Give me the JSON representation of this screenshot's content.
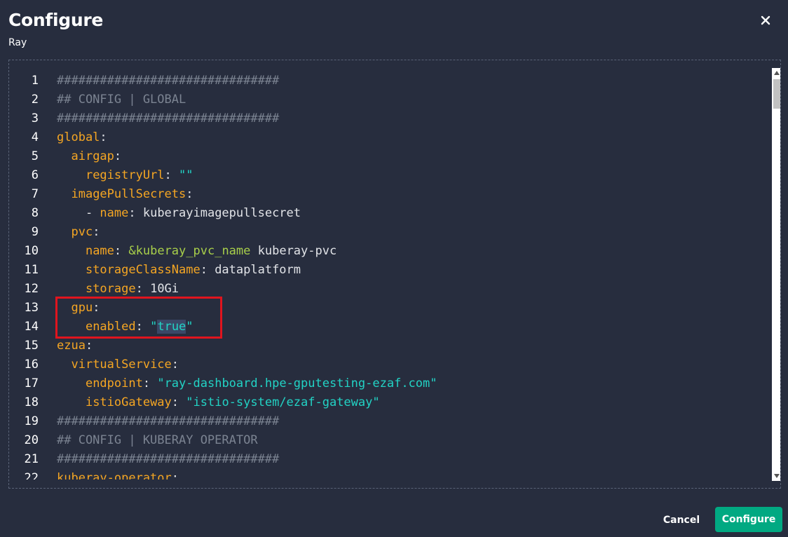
{
  "dialog": {
    "title": "Configure",
    "subtitle": "Ray",
    "close_icon": "close-icon"
  },
  "editor": {
    "lines": [
      {
        "num": "1",
        "segs": [
          {
            "t": "###############################",
            "c": "comment"
          }
        ]
      },
      {
        "num": "2",
        "segs": [
          {
            "t": "## CONFIG | GLOBAL",
            "c": "comment"
          }
        ]
      },
      {
        "num": "3",
        "segs": [
          {
            "t": "###############################",
            "c": "comment"
          }
        ]
      },
      {
        "num": "4",
        "segs": [
          {
            "t": "global",
            "c": "key"
          },
          {
            "t": ":",
            "c": "plain"
          }
        ]
      },
      {
        "num": "5",
        "segs": [
          {
            "t": "  ",
            "c": "plain"
          },
          {
            "t": "airgap",
            "c": "key"
          },
          {
            "t": ":",
            "c": "plain"
          }
        ]
      },
      {
        "num": "6",
        "segs": [
          {
            "t": "    ",
            "c": "plain"
          },
          {
            "t": "registryUrl",
            "c": "key"
          },
          {
            "t": ": ",
            "c": "plain"
          },
          {
            "t": "\"\"",
            "c": "str"
          }
        ]
      },
      {
        "num": "7",
        "segs": [
          {
            "t": "  ",
            "c": "plain"
          },
          {
            "t": "imagePullSecrets",
            "c": "key"
          },
          {
            "t": ":",
            "c": "plain"
          }
        ]
      },
      {
        "num": "8",
        "segs": [
          {
            "t": "    - ",
            "c": "plain"
          },
          {
            "t": "name",
            "c": "key"
          },
          {
            "t": ": kuberayimagepullsecret",
            "c": "plain"
          }
        ]
      },
      {
        "num": "9",
        "segs": [
          {
            "t": "  ",
            "c": "plain"
          },
          {
            "t": "pvc",
            "c": "key"
          },
          {
            "t": ":",
            "c": "plain"
          }
        ]
      },
      {
        "num": "10",
        "segs": [
          {
            "t": "    ",
            "c": "plain"
          },
          {
            "t": "name",
            "c": "key"
          },
          {
            "t": ": ",
            "c": "plain"
          },
          {
            "t": "&kuberay_pvc_name",
            "c": "anchor"
          },
          {
            "t": " kuberay-pvc",
            "c": "plain"
          }
        ]
      },
      {
        "num": "11",
        "segs": [
          {
            "t": "    ",
            "c": "plain"
          },
          {
            "t": "storageClassName",
            "c": "key"
          },
          {
            "t": ": dataplatform",
            "c": "plain"
          }
        ]
      },
      {
        "num": "12",
        "segs": [
          {
            "t": "    ",
            "c": "plain"
          },
          {
            "t": "storage",
            "c": "key"
          },
          {
            "t": ": 10Gi",
            "c": "plain"
          }
        ]
      },
      {
        "num": "13",
        "segs": [
          {
            "t": "  ",
            "c": "plain"
          },
          {
            "t": "gpu",
            "c": "key"
          },
          {
            "t": ":",
            "c": "plain"
          }
        ]
      },
      {
        "num": "14",
        "segs": [
          {
            "t": "    ",
            "c": "plain"
          },
          {
            "t": "enabled",
            "c": "key"
          },
          {
            "t": ": ",
            "c": "plain"
          },
          {
            "t": "\"",
            "c": "str"
          },
          {
            "t": "true",
            "c": "str",
            "sel": true
          },
          {
            "t": "\"",
            "c": "str"
          }
        ]
      },
      {
        "num": "15",
        "segs": [
          {
            "t": "ezua",
            "c": "key"
          },
          {
            "t": ":",
            "c": "plain"
          }
        ]
      },
      {
        "num": "16",
        "segs": [
          {
            "t": "  ",
            "c": "plain"
          },
          {
            "t": "virtualService",
            "c": "key"
          },
          {
            "t": ":",
            "c": "plain"
          }
        ]
      },
      {
        "num": "17",
        "segs": [
          {
            "t": "    ",
            "c": "plain"
          },
          {
            "t": "endpoint",
            "c": "key"
          },
          {
            "t": ": ",
            "c": "plain"
          },
          {
            "t": "\"ray-dashboard.hpe-gputesting-ezaf.com\"",
            "c": "str"
          }
        ]
      },
      {
        "num": "18",
        "segs": [
          {
            "t": "    ",
            "c": "plain"
          },
          {
            "t": "istioGateway",
            "c": "key"
          },
          {
            "t": ": ",
            "c": "plain"
          },
          {
            "t": "\"istio-system/ezaf-gateway\"",
            "c": "str"
          }
        ]
      },
      {
        "num": "19",
        "segs": [
          {
            "t": "###############################",
            "c": "comment"
          }
        ]
      },
      {
        "num": "20",
        "segs": [
          {
            "t": "## CONFIG | KUBERAY OPERATOR",
            "c": "comment"
          }
        ]
      },
      {
        "num": "21",
        "segs": [
          {
            "t": "###############################",
            "c": "comment"
          }
        ]
      },
      {
        "num": "22",
        "segs": [
          {
            "t": "kuberay-operator",
            "c": "key"
          },
          {
            "t": ":",
            "c": "plain"
          }
        ]
      }
    ],
    "scroll_up_icon": "caret-up-icon",
    "scroll_down_icon": "caret-down-icon"
  },
  "footer": {
    "cancel_label": "Cancel",
    "configure_label": "Configure"
  },
  "colors": {
    "background": "#272d3e",
    "comment": "#7b8391",
    "key": "#f5a623",
    "string": "#22d3c5",
    "anchor": "#a8cf4a",
    "highlight_box": "#e0141e",
    "primary_button": "#01a982"
  }
}
